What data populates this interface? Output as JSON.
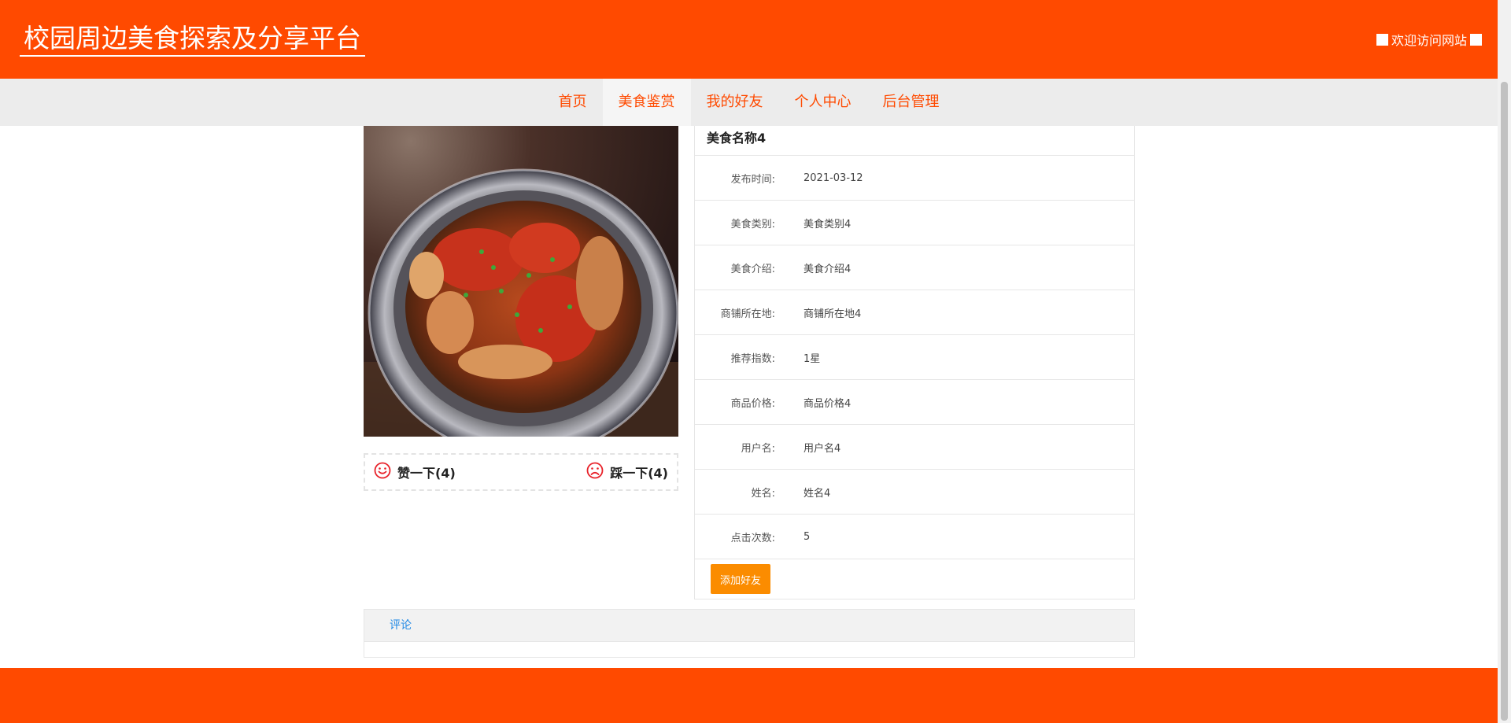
{
  "header": {
    "site_title": "校园周边美食探索及分享平台",
    "welcome_text": "欢迎访问网站"
  },
  "nav": {
    "items": [
      {
        "label": "首页"
      },
      {
        "label": "美食鉴赏",
        "active": true
      },
      {
        "label": "我的好友"
      },
      {
        "label": "个人中心"
      },
      {
        "label": "后台管理"
      }
    ]
  },
  "votes": {
    "like_label": "赞一下(4)",
    "dislike_label": "踩一下(4)"
  },
  "detail": {
    "name": "美食名称4",
    "rows": [
      {
        "key": "发布时间:",
        "value": "2021-03-12"
      },
      {
        "key": "美食类别:",
        "value": "美食类别4"
      },
      {
        "key": "美食介绍:",
        "value": "美食介绍4"
      },
      {
        "key": "商铺所在地:",
        "value": "商铺所在地4"
      },
      {
        "key": "推荐指数:",
        "value": "1星"
      },
      {
        "key": "商品价格:",
        "value": "商品价格4"
      },
      {
        "key": "用户名:",
        "value": "用户名4"
      },
      {
        "key": "姓名:",
        "value": "姓名4"
      },
      {
        "key": "点击次数:",
        "value": "5"
      }
    ],
    "add_friend_label": "添加好友"
  },
  "comments": {
    "tab_label": "评论"
  },
  "colors": {
    "brand": "#ff4a00",
    "button": "#fb8c00",
    "link": "#1e88e5"
  },
  "icons": {
    "like": "smile-icon",
    "dislike": "frown-icon"
  }
}
